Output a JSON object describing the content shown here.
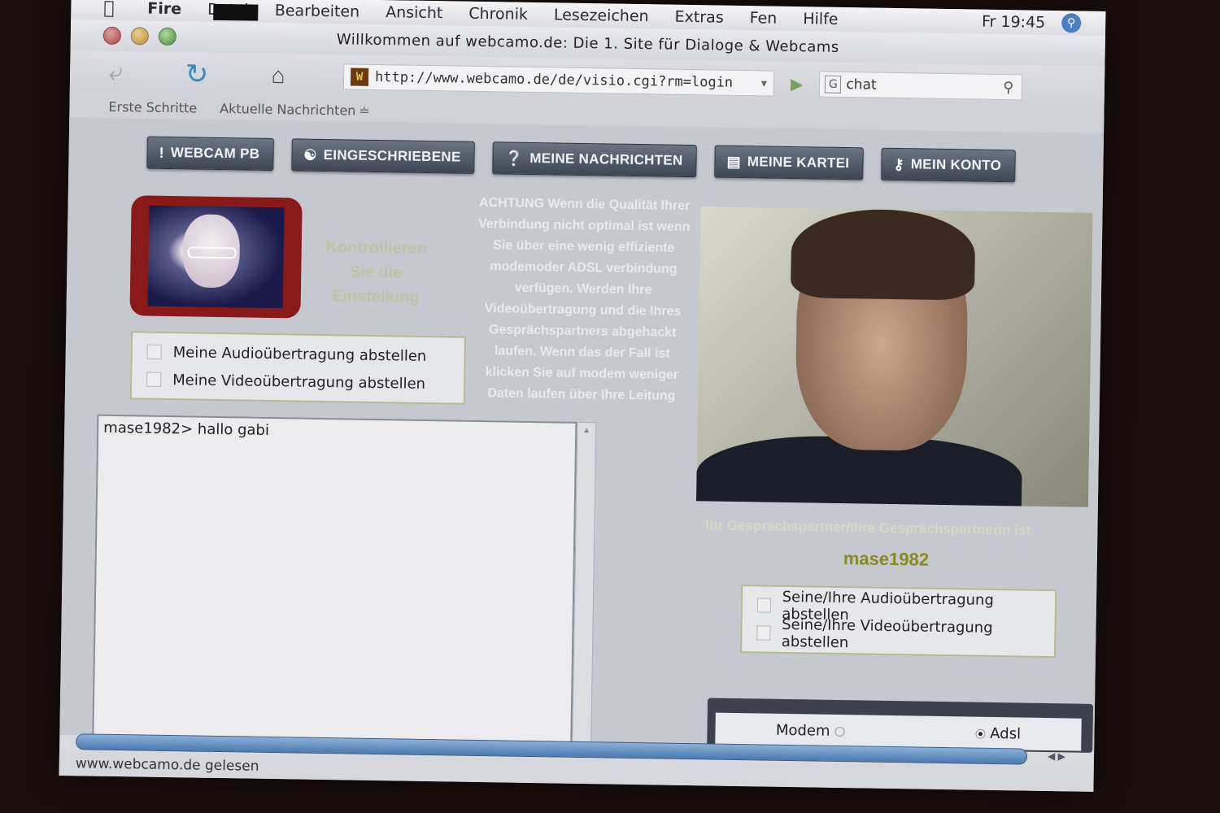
{
  "menubar": {
    "app": "Fire",
    "items": [
      "Datei",
      "Bearbeiten",
      "Ansicht",
      "Chronik",
      "Lesezeichen",
      "Extras",
      "Fen",
      "Hilfe"
    ],
    "clock": "Fr 19:45"
  },
  "window": {
    "title": "Willkommen auf webcamo.de: Die 1. Site für Dialoge & Webcams"
  },
  "toolbar": {
    "url": "http://www.webcamo.de/de/visio.cgi?rm=login",
    "search_value": "chat"
  },
  "bookmarks": [
    "Erste Schritte",
    "Aktuelle Nachrichten"
  ],
  "nav_buttons": [
    "WEBCAM PB",
    "EINGESCHRIEBENE",
    "MEINE NACHRICHTEN",
    "MEINE KARTEI",
    "MEIN KONTO"
  ],
  "self": {
    "faded_hint": "Kontrollieren Sie die Einstellung",
    "audio_label": "Meine Audioübertragung abstellen",
    "video_label": "Meine Videoübertragung abstellen"
  },
  "warning_text": "ACHTUNG Wenn die Qualität Ihrer Verbindung nicht optimal ist wenn Sie über eine wenig effiziente modemoder ADSL verbindung verfügen. Werden Ihre Videoübertragung und die Ihres Gesprächspartners abgehackt laufen. Wenn das der Fall ist klicken Sie auf modem weniger Daten laufen über Ihre Leitung",
  "chat": {
    "line": "mase1982> hallo gabi"
  },
  "partner": {
    "caption": "Ihr Gesprächspartner/Ihre Gesprächspartnerin ist",
    "name": "mase1982",
    "audio_label": "Seine/Ihre Audioübertragung abstellen",
    "video_label": "Seine/Ihre Videoübertragung abstellen"
  },
  "connection": {
    "modem": "Modem",
    "adsl": "Adsl",
    "selected": "Adsl"
  },
  "status": "www.webcamo.de gelesen"
}
